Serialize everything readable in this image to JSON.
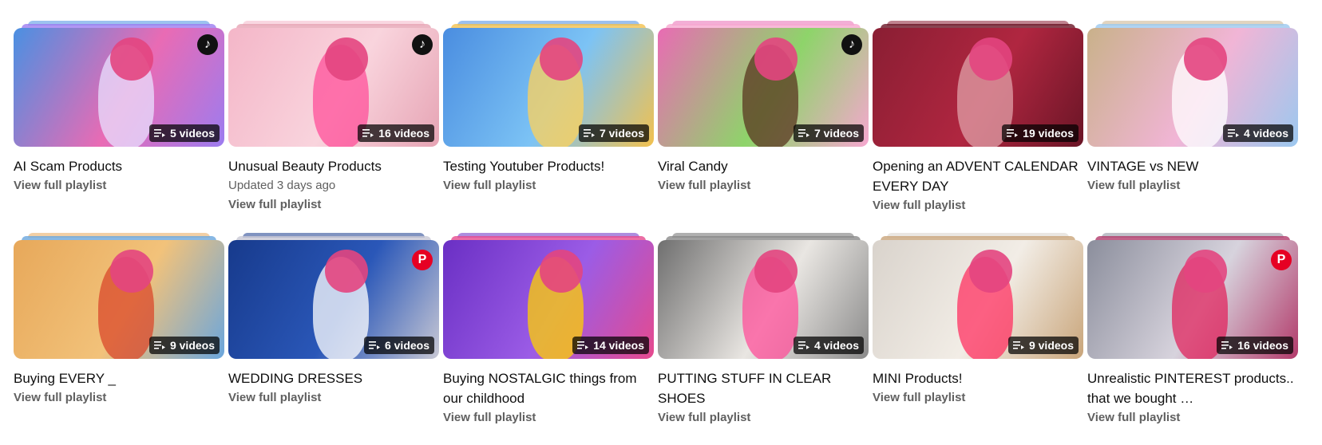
{
  "view_full_label": "View full playlist",
  "playlists": [
    {
      "title": "AI Scam Products",
      "count": "5 videos",
      "updated": "",
      "colors": [
        "#4a90e2",
        "#e96bb4",
        "#9c7cf0"
      ],
      "accent": "#e8e0ff",
      "icon": "tiktok-icon"
    },
    {
      "title": "Unusual Beauty Products",
      "count": "16 videos",
      "updated": "Updated 3 days ago",
      "colors": [
        "#f4b6c8",
        "#f9d4dd",
        "#e6a4b4"
      ],
      "accent": "#ff4f9a",
      "icon": "tiktok-icon"
    },
    {
      "title": "Testing Youtuber Products!",
      "count": "7 videos",
      "updated": "",
      "colors": [
        "#4a8de0",
        "#7cc3f5",
        "#f2c14e"
      ],
      "accent": "#ffd25a",
      "icon": ""
    },
    {
      "title": "Viral Candy",
      "count": "7 videos",
      "updated": "",
      "colors": [
        "#e96bb4",
        "#8ed46a",
        "#f6a7d0"
      ],
      "accent": "#5a3520",
      "icon": "tiktok-icon"
    },
    {
      "title": "Opening an ADVENT CALENDAR EVERY DAY",
      "count": "19 videos",
      "updated": "",
      "colors": [
        "#8a1e33",
        "#b02640",
        "#6a1526"
      ],
      "accent": "#e0a0a8",
      "icon": ""
    },
    {
      "title": "VINTAGE vs NEW",
      "count": "4 videos",
      "updated": "",
      "colors": [
        "#c9b18a",
        "#f1b5d6",
        "#9bc8ef"
      ],
      "accent": "#ffffff",
      "icon": ""
    },
    {
      "title": "Buying EVERY _",
      "count": "9 videos",
      "updated": "",
      "colors": [
        "#e7a85a",
        "#f2c27a",
        "#6aa6dd"
      ],
      "accent": "#d9482b",
      "icon": ""
    },
    {
      "title": "WEDDING DRESSES",
      "count": "6 videos",
      "updated": "",
      "colors": [
        "#173a8c",
        "#2a57b8",
        "#c8c8d4"
      ],
      "accent": "#ffffff",
      "icon": "pinterest-icon"
    },
    {
      "title": "Buying NOSTALGIC things from our childhood",
      "count": "14 videos",
      "updated": "",
      "colors": [
        "#6a2fc4",
        "#9b5ce6",
        "#e64a8e"
      ],
      "accent": "#ffd000",
      "icon": ""
    },
    {
      "title": "PUTTING STUFF IN CLEAR SHOES",
      "count": "4 videos",
      "updated": "",
      "colors": [
        "#6f6f6f",
        "#e9e6e2",
        "#8a8a8a"
      ],
      "accent": "#ff4f9a",
      "icon": ""
    },
    {
      "title": "MINI Products!",
      "count": "9 videos",
      "updated": "",
      "colors": [
        "#d9d3cc",
        "#f2ede6",
        "#c9a57a"
      ],
      "accent": "#ff3060",
      "icon": ""
    },
    {
      "title": "Unrealistic PINTEREST products.. that we bought …",
      "count": "16 videos",
      "updated": "",
      "colors": [
        "#8b8e9c",
        "#d7d3dd",
        "#b23a6a"
      ],
      "accent": "#e0245e",
      "icon": "pinterest-icon"
    }
  ]
}
